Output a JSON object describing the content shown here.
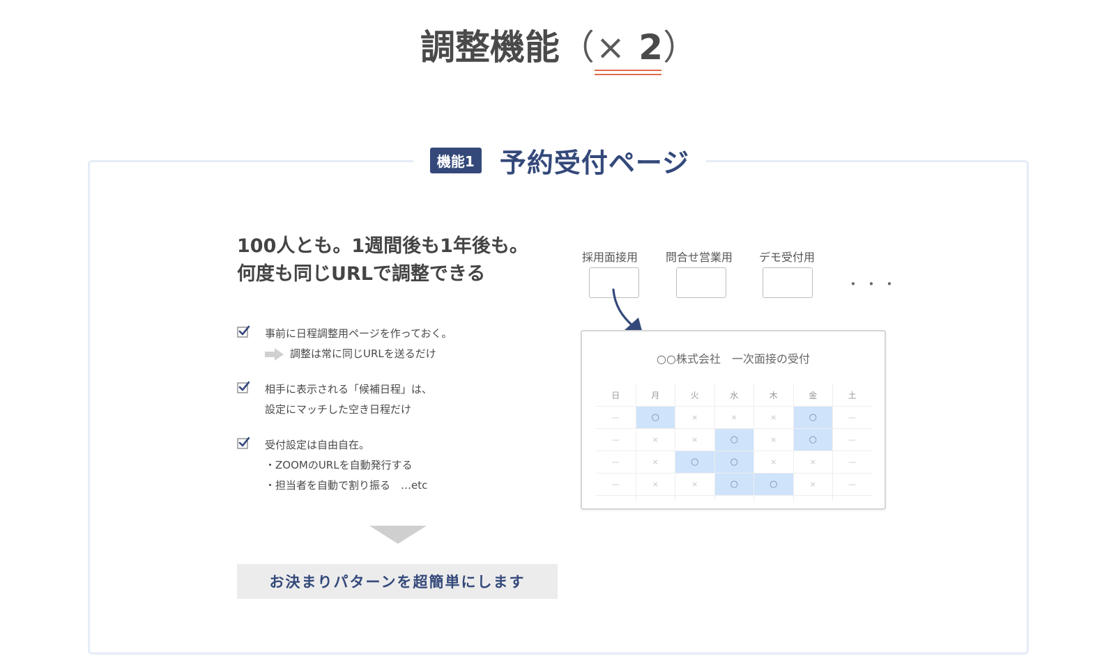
{
  "page_title": {
    "main": "調整機能",
    "open_paren": "（",
    "times": "×",
    "count": "2",
    "close_paren": "）"
  },
  "feature": {
    "badge": "機能1",
    "name": "予約受付ページ"
  },
  "headline": {
    "line1": "100人とも。1週間後も1年後も。",
    "line2": "何度も同じURLで調整できる"
  },
  "checklist": [
    {
      "line1": "事前に日程調整用ページを作っておく。",
      "line2": "調整は常に同じURLを送るだけ"
    },
    {
      "line1": "相手に表示される「候補日程」は、",
      "line2": "設定にマッチした空き日程だけ"
    },
    {
      "line1": "受付設定は自由自在。",
      "line2": "・ZOOMのURLを自動発行する",
      "line3": "・担当者を自動で割り振る　…etc"
    }
  ],
  "cta": {
    "label": "お決まりパターンを超簡単にします"
  },
  "page_tabs": {
    "tab1": "採用面接用",
    "tab2": "問合せ営業用",
    "tab3": "デモ受付用",
    "ellipsis": "・・・"
  },
  "calendar": {
    "title": "○○株式会社　一次面接の受付",
    "days": [
      "日",
      "月",
      "火",
      "水",
      "木",
      "金",
      "土"
    ],
    "rows": [
      [
        "—",
        "○",
        "×",
        "×",
        "×",
        "○",
        "—"
      ],
      [
        "—",
        "×",
        "×",
        "○",
        "×",
        "○",
        "—"
      ],
      [
        "—",
        "×",
        "○",
        "○",
        "×",
        "×",
        "—"
      ],
      [
        "—",
        "×",
        "×",
        "○",
        "○",
        "×",
        "—"
      ]
    ],
    "available_symbol": "○"
  },
  "colors": {
    "navy": "#34497a",
    "accent_red": "#e06a4c",
    "highlight_blue": "#cfe3fb",
    "box_border": "#e4ecf6",
    "cta_bg": "#ececec"
  },
  "icons": {
    "check": "checkbox-checked-icon",
    "right_arrow": "right-arrow-icon",
    "down_arrow": "down-triangle-icon",
    "pointer": "curved-arrow-icon"
  }
}
